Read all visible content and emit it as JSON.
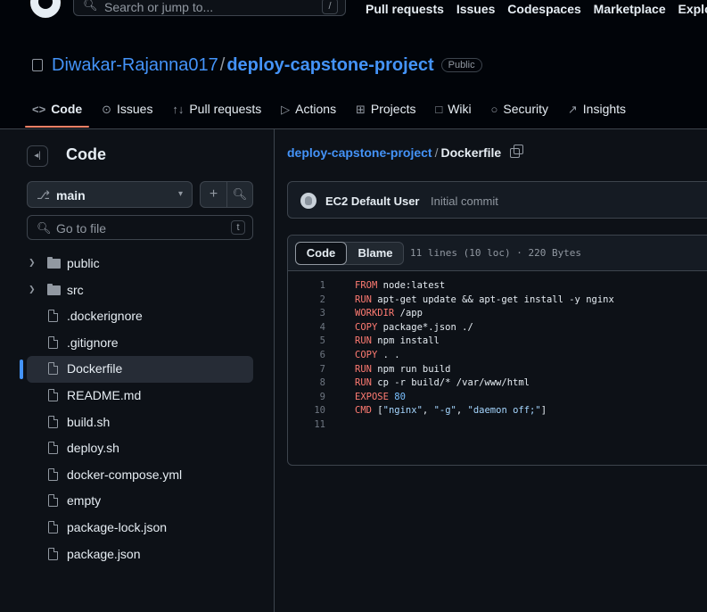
{
  "topbar": {
    "search_placeholder": "Search or jump to...",
    "search_shortcut": "/",
    "links": [
      "Pull requests",
      "Issues",
      "Codespaces",
      "Marketplace",
      "Explore"
    ]
  },
  "repo": {
    "owner": "Diwakar-Rajanna017",
    "separator": "/",
    "name": "deploy-capstone-project",
    "visibility": "Public"
  },
  "tabs": [
    {
      "label": "Code",
      "icon": "code-icon",
      "active": true
    },
    {
      "label": "Issues",
      "icon": "issue-icon"
    },
    {
      "label": "Pull requests",
      "icon": "pull-request-icon"
    },
    {
      "label": "Actions",
      "icon": "play-icon"
    },
    {
      "label": "Projects",
      "icon": "table-icon"
    },
    {
      "label": "Wiki",
      "icon": "book-icon"
    },
    {
      "label": "Security",
      "icon": "shield-icon"
    },
    {
      "label": "Insights",
      "icon": "graph-icon"
    }
  ],
  "sidebar": {
    "title": "Code",
    "branch": "main",
    "add_label": "+",
    "goto_placeholder": "Go to file",
    "goto_shortcut": "t",
    "files": [
      {
        "name": "public",
        "type": "folder"
      },
      {
        "name": "src",
        "type": "folder"
      },
      {
        "name": ".dockerignore",
        "type": "file"
      },
      {
        "name": ".gitignore",
        "type": "file"
      },
      {
        "name": "Dockerfile",
        "type": "file",
        "selected": true
      },
      {
        "name": "README.md",
        "type": "file"
      },
      {
        "name": "build.sh",
        "type": "file"
      },
      {
        "name": "deploy.sh",
        "type": "file"
      },
      {
        "name": "docker-compose.yml",
        "type": "file"
      },
      {
        "name": "empty",
        "type": "file"
      },
      {
        "name": "package-lock.json",
        "type": "file"
      },
      {
        "name": "package.json",
        "type": "file"
      }
    ]
  },
  "breadcrumb": {
    "repo": "deploy-capstone-project",
    "separator": "/",
    "file": "Dockerfile"
  },
  "commit": {
    "author": "EC2 Default User",
    "message": "Initial commit"
  },
  "code_view": {
    "tab_code": "Code",
    "tab_blame": "Blame",
    "file_info": "11 lines (10 loc) · 220 Bytes",
    "lines": [
      {
        "n": "1",
        "kw": "FROM",
        "rest": " node:latest"
      },
      {
        "n": "2",
        "kw": "RUN",
        "rest": " apt-get update && apt-get install -y nginx"
      },
      {
        "n": "3",
        "kw": "WORKDIR",
        "rest": " /app"
      },
      {
        "n": "4",
        "kw": "COPY",
        "rest": " package*.json ./"
      },
      {
        "n": "5",
        "kw": "RUN",
        "rest": " npm install"
      },
      {
        "n": "6",
        "kw": "COPY",
        "rest": " . ."
      },
      {
        "n": "7",
        "kw": "RUN",
        "rest": " npm run build"
      },
      {
        "n": "8",
        "kw": "RUN",
        "rest": " cp -r build/* /var/www/html"
      },
      {
        "n": "9",
        "kw": "EXPOSE",
        "rest": " 80"
      },
      {
        "n": "10",
        "kw": "CMD",
        "rest": " [\"nginx\", \"-g\", \"daemon off;\"]"
      },
      {
        "n": "11",
        "kw": "",
        "rest": ""
      }
    ]
  },
  "colors": {
    "accent_blue": "#4493f8",
    "tab_underline": "#f78166",
    "keyword": "#ff7b72",
    "string": "#a5d6ff",
    "number": "#79c0ff",
    "background": "#0d1117"
  }
}
